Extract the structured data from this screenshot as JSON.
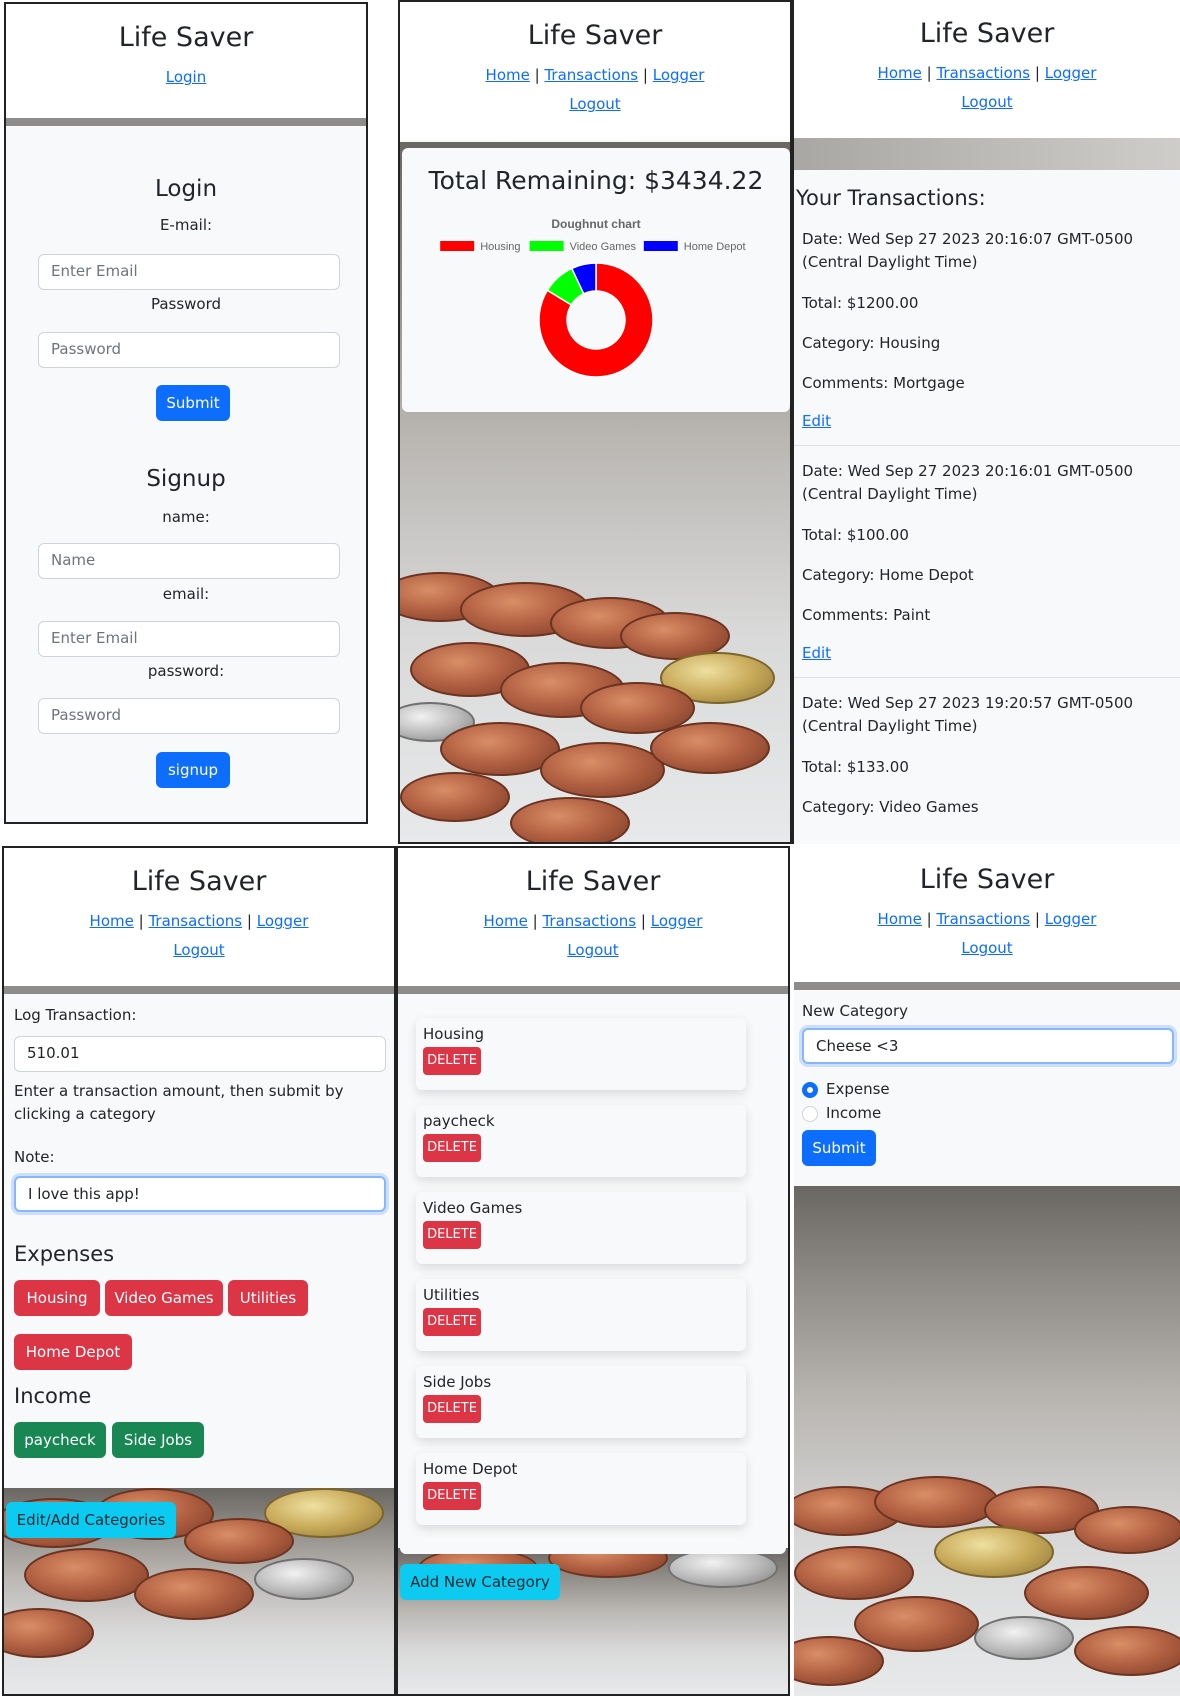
{
  "app": {
    "title": "Life Saver"
  },
  "nav": {
    "login": "Login",
    "home": "Home",
    "transactions": "Transactions",
    "logger": "Logger",
    "logout": "Logout",
    "separator": "|"
  },
  "login_screen": {
    "login_heading": "Login",
    "email_label": "E-mail:",
    "email_placeholder": "Enter Email",
    "password_label": "Password",
    "password_placeholder": "Password",
    "submit_label": "Submit",
    "signup_heading": "Signup",
    "name_label": "name:",
    "name_placeholder": "Name",
    "signup_email_label": "email:",
    "signup_email_placeholder": "Enter Email",
    "signup_password_label": "password:",
    "signup_password_placeholder": "Password",
    "signup_button": "signup"
  },
  "home_screen": {
    "total_remaining": "Total Remaining: $3434.22",
    "chart_title": "Doughnut chart"
  },
  "chart_data": {
    "type": "pie",
    "title": "Doughnut chart",
    "categories": [
      "Housing",
      "Video Games",
      "Home Depot"
    ],
    "values": [
      1200,
      133,
      100
    ],
    "colors": [
      "#ff0000",
      "#00ff00",
      "#0000ff"
    ],
    "legend": "top"
  },
  "transactions_screen": {
    "heading": "Your Transactions:",
    "items": [
      {
        "date": "Date: Wed Sep 27 2023 20:16:07 GMT-0500 (Central Daylight Time)",
        "total": "Total: $1200.00",
        "category": "Category: Housing",
        "comments": "Comments: Mortgage",
        "edit": "Edit"
      },
      {
        "date": "Date: Wed Sep 27 2023 20:16:01 GMT-0500 (Central Daylight Time)",
        "total": "Total: $100.00",
        "category": "Category: Home Depot",
        "comments": "Comments: Paint",
        "edit": "Edit"
      },
      {
        "date": "Date: Wed Sep 27 2023 19:20:57 GMT-0500 (Central Daylight Time)",
        "total": "Total: $133.00",
        "category": "Category: Video Games"
      }
    ]
  },
  "logger_screen": {
    "log_label": "Log Transaction:",
    "amount_value": "510.01",
    "help_text": "Enter a transaction amount, then submit by clicking a category",
    "note_label": "Note:",
    "note_value": "I love this app!",
    "expenses_heading": "Expenses",
    "expense_buttons": [
      "Housing",
      "Video Games",
      "Utilities",
      "Home Depot"
    ],
    "income_heading": "Income",
    "income_buttons": [
      "paycheck",
      "Side Jobs"
    ],
    "edit_categories": "Edit/Add Categories"
  },
  "categories_screen": {
    "categories": [
      "Housing",
      "paycheck",
      "Video Games",
      "Utilities",
      "Side Jobs",
      "Home Depot"
    ],
    "delete_label": "DELETE",
    "add_new": "Add New Category"
  },
  "new_category_screen": {
    "label": "New Category",
    "input_value": "Cheese <3",
    "expense_label": "Expense",
    "income_label": "Income",
    "submit_label": "Submit"
  }
}
